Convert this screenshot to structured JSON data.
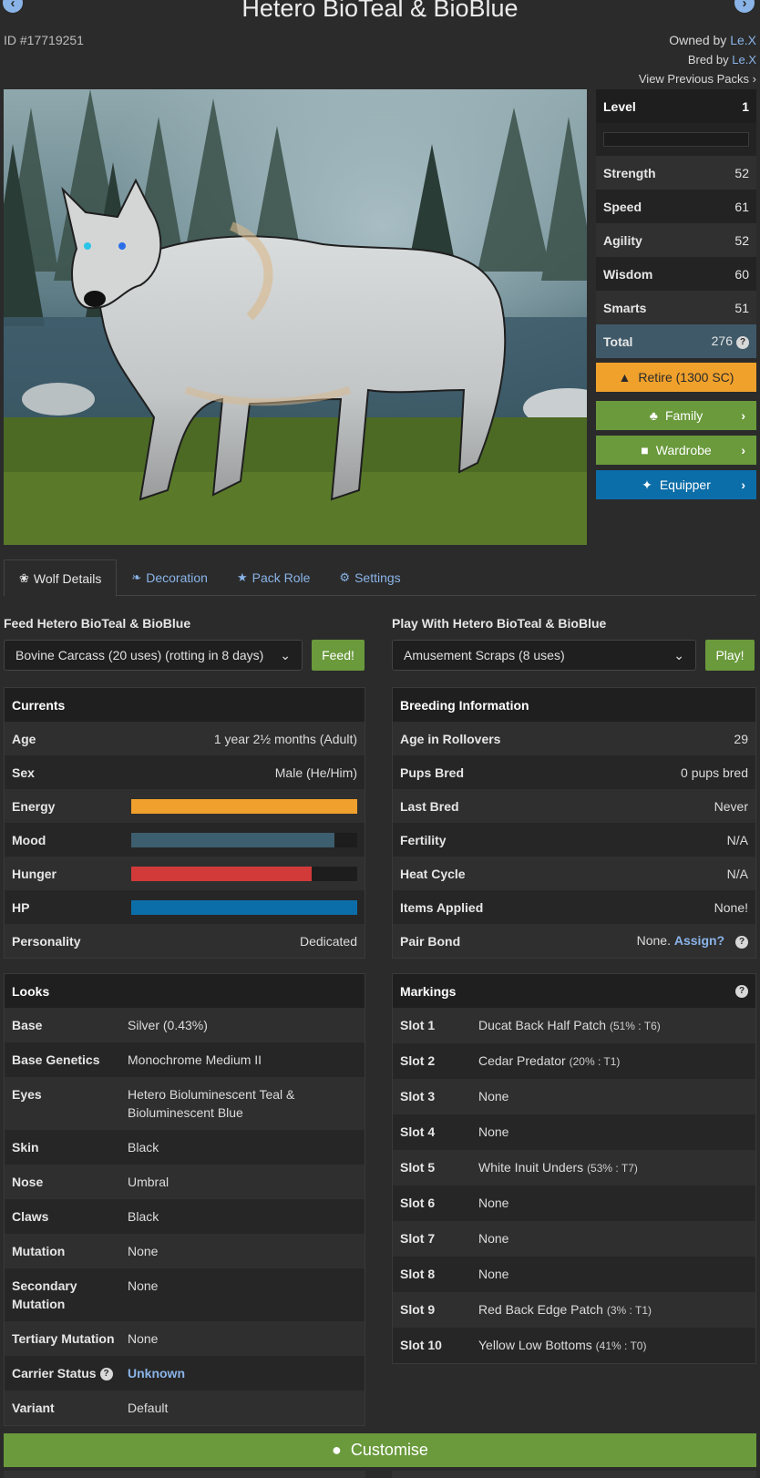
{
  "header": {
    "title": "Hetero BioTeal & BioBlue",
    "id": "ID #17719251",
    "owned_prefix": "Owned by",
    "owner": "Le.X",
    "bred_prefix": "Bred by",
    "breeder": "Le.X",
    "previous_packs": "View Previous Packs"
  },
  "stats": {
    "level_label": "Level",
    "level": "1",
    "rows": [
      {
        "label": "Strength",
        "value": "52"
      },
      {
        "label": "Speed",
        "value": "61"
      },
      {
        "label": "Agility",
        "value": "52"
      },
      {
        "label": "Wisdom",
        "value": "60"
      },
      {
        "label": "Smarts",
        "value": "51"
      }
    ],
    "total_label": "Total",
    "total": "276"
  },
  "actions": {
    "retire": "Retire (1300 SC)",
    "family": "Family",
    "wardrobe": "Wardrobe",
    "equipper": "Equipper"
  },
  "tabs": [
    {
      "label": "Wolf Details",
      "icon": "paw-icon"
    },
    {
      "label": "Decoration",
      "icon": "leaf-icon"
    },
    {
      "label": "Pack Role",
      "icon": "star-icon"
    },
    {
      "label": "Settings",
      "icon": "gear-icon"
    }
  ],
  "feed": {
    "label": "Feed Hetero BioTeal & BioBlue",
    "selected": "Bovine Carcass (20 uses) (rotting in 8 days)",
    "button": "Feed!"
  },
  "play": {
    "label": "Play With Hetero BioTeal & BioBlue",
    "selected": "Amusement Scraps (8 uses)",
    "button": "Play!"
  },
  "currents": {
    "title": "Currents",
    "age_label": "Age",
    "age": "1 year 2½ months (Adult)",
    "sex_label": "Sex",
    "sex": "Male (He/Him)",
    "bars": [
      {
        "label": "Energy",
        "fill": 1.0,
        "color": "#f0a02c"
      },
      {
        "label": "Mood",
        "fill": 0.9,
        "color": "#3d5e6e"
      },
      {
        "label": "Hunger",
        "fill": 0.8,
        "color": "#d23a3a"
      },
      {
        "label": "HP",
        "fill": 1.0,
        "color": "#0c6ea8"
      }
    ],
    "personality_label": "Personality",
    "personality": "Dedicated"
  },
  "breeding": {
    "title": "Breeding Information",
    "rows": [
      {
        "label": "Age in Rollovers",
        "value": "29"
      },
      {
        "label": "Pups Bred",
        "value": "0 pups bred"
      },
      {
        "label": "Last Bred",
        "value": "Never"
      },
      {
        "label": "Fertility",
        "value": "N/A"
      },
      {
        "label": "Heat Cycle",
        "value": "N/A"
      },
      {
        "label": "Items Applied",
        "value": "None!"
      }
    ],
    "pair_bond_label": "Pair Bond",
    "pair_bond": "None.",
    "assign": "Assign?"
  },
  "looks": {
    "title": "Looks",
    "rows": [
      {
        "label": "Base",
        "value": "Silver (0.43%)"
      },
      {
        "label": "Base Genetics",
        "value": "Monochrome Medium II"
      },
      {
        "label": "Eyes",
        "value": "Hetero Bioluminescent Teal & Bioluminescent Blue"
      },
      {
        "label": "Skin",
        "value": "Black"
      },
      {
        "label": "Nose",
        "value": "Umbral"
      },
      {
        "label": "Claws",
        "value": "Black"
      },
      {
        "label": "Mutation",
        "value": "None"
      },
      {
        "label": "Secondary Mutation",
        "value": "None"
      },
      {
        "label": "Tertiary Mutation",
        "value": "None"
      }
    ],
    "carrier_label": "Carrier Status",
    "carrier": "Unknown",
    "variant_label": "Variant",
    "variant": "Default"
  },
  "markings": {
    "title": "Markings",
    "rows": [
      {
        "label": "Slot 1",
        "value": "Ducat Back Half Patch",
        "detail": "(51% : T6)"
      },
      {
        "label": "Slot 2",
        "value": "Cedar Predator",
        "detail": "(20% : T1)"
      },
      {
        "label": "Slot 3",
        "value": "None",
        "detail": ""
      },
      {
        "label": "Slot 4",
        "value": "None",
        "detail": ""
      },
      {
        "label": "Slot 5",
        "value": "White Inuit Unders",
        "detail": "(53% : T7)"
      },
      {
        "label": "Slot 6",
        "value": "None",
        "detail": ""
      },
      {
        "label": "Slot 7",
        "value": "None",
        "detail": ""
      },
      {
        "label": "Slot 8",
        "value": "None",
        "detail": ""
      },
      {
        "label": "Slot 9",
        "value": "Red Back Edge Patch",
        "detail": "(3% : T1)"
      },
      {
        "label": "Slot 10",
        "value": "Yellow Low Bottoms",
        "detail": "(41% : T0)"
      }
    ]
  },
  "customise": "Customise"
}
